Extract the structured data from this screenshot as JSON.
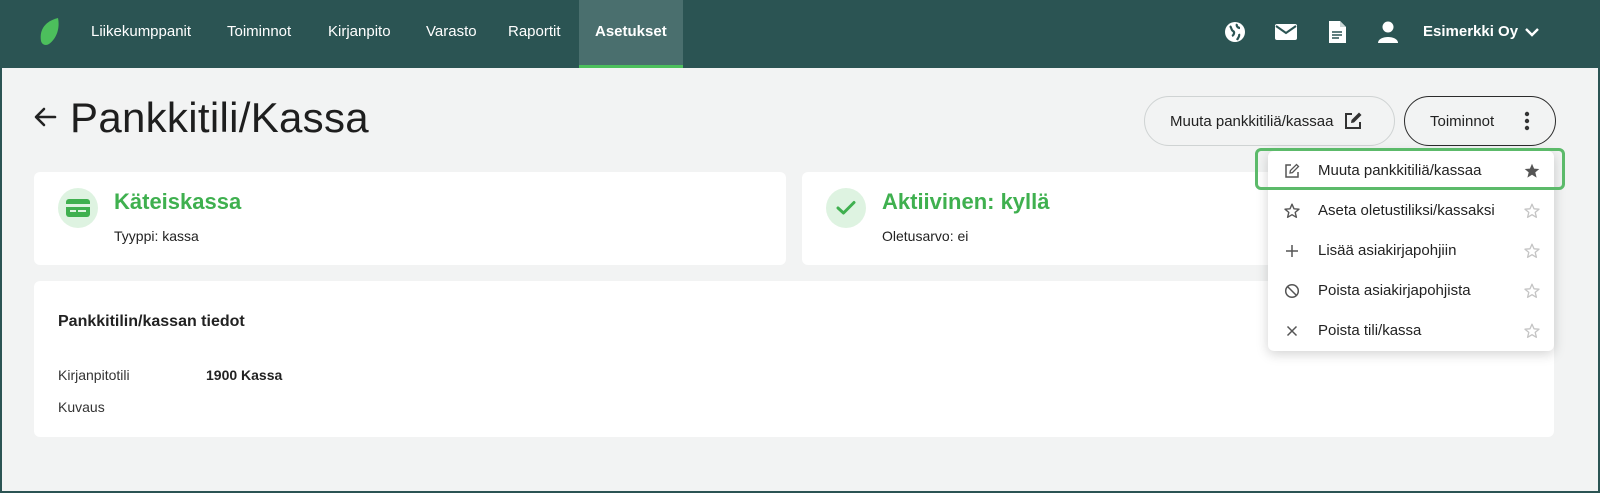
{
  "nav": {
    "items": [
      {
        "label": "Liikekumppanit"
      },
      {
        "label": "Toiminnot"
      },
      {
        "label": "Kirjanpito"
      },
      {
        "label": "Varasto"
      },
      {
        "label": "Raportit"
      },
      {
        "label": "Asetukset",
        "active": true
      }
    ],
    "icons": [
      "globe-icon",
      "mail-icon",
      "document-icon",
      "user-icon"
    ],
    "company": "Esimerkki Oy"
  },
  "header": {
    "title": "Pankkitili/Kassa",
    "edit_button": "Muuta pankkitiliä/kassaa",
    "actions_button": "Toiminnot"
  },
  "cards": {
    "cash": {
      "title": "Käteiskassa",
      "subtitle": "Tyyppi: kassa"
    },
    "status": {
      "title": "Aktiivinen: kyllä",
      "subtitle": "Oletusarvo: ei"
    }
  },
  "details": {
    "title": "Pankkitilin/kassan tiedot",
    "fields": [
      {
        "label": "Kirjanpitotili",
        "value": "1900 Kassa"
      },
      {
        "label": "Kuvaus",
        "value": ""
      }
    ]
  },
  "dropdown": {
    "items": [
      {
        "label": "Muuta pankkitiliä/kassaa",
        "icon": "edit-icon",
        "starred": true
      },
      {
        "label": "Aseta oletustiliksi/kassaksi",
        "icon": "star-outline-icon",
        "starred": false
      },
      {
        "label": "Lisää asiakirjapohjiin",
        "icon": "plus-icon",
        "starred": false
      },
      {
        "label": "Poista asiakirjapohjista",
        "icon": "ban-icon",
        "starred": false
      },
      {
        "label": "Poista tili/kassa",
        "icon": "close-icon",
        "starred": false
      }
    ]
  },
  "colors": {
    "topbar": "#2b5453",
    "accent_green": "#3fb04f",
    "highlight": "#5cba6a"
  }
}
